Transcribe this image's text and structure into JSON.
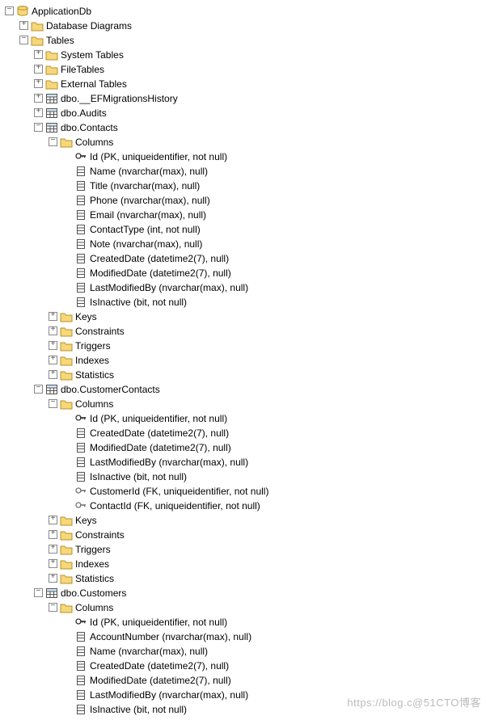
{
  "watermark": "https://blog.c@51CTO博客",
  "tree": [
    {
      "d": 0,
      "t": "minus",
      "i": "db",
      "name": "db-applicationdb",
      "label": "ApplicationDb"
    },
    {
      "d": 1,
      "t": "plus",
      "i": "folder",
      "name": "folder-database-diagrams",
      "label": "Database Diagrams"
    },
    {
      "d": 1,
      "t": "minus",
      "i": "folder",
      "name": "folder-tables",
      "label": "Tables"
    },
    {
      "d": 2,
      "t": "plus",
      "i": "folder",
      "name": "folder-system-tables",
      "label": "System Tables"
    },
    {
      "d": 2,
      "t": "plus",
      "i": "folder",
      "name": "folder-file-tables",
      "label": "FileTables"
    },
    {
      "d": 2,
      "t": "plus",
      "i": "folder",
      "name": "folder-external-tables",
      "label": "External Tables"
    },
    {
      "d": 2,
      "t": "plus",
      "i": "table",
      "name": "table-efmigrationshistory",
      "label": "dbo.__EFMigrationsHistory"
    },
    {
      "d": 2,
      "t": "plus",
      "i": "table",
      "name": "table-audits",
      "label": "dbo.Audits"
    },
    {
      "d": 2,
      "t": "minus",
      "i": "table",
      "name": "table-contacts",
      "label": "dbo.Contacts"
    },
    {
      "d": 3,
      "t": "minus",
      "i": "folder",
      "name": "folder-contacts-columns",
      "label": "Columns"
    },
    {
      "d": 4,
      "t": "",
      "i": "pk",
      "name": "col-contacts-id",
      "label": "Id (PK, uniqueidentifier, not null)"
    },
    {
      "d": 4,
      "t": "",
      "i": "col",
      "name": "col-contacts-name",
      "label": "Name (nvarchar(max), null)"
    },
    {
      "d": 4,
      "t": "",
      "i": "col",
      "name": "col-contacts-title",
      "label": "Title (nvarchar(max), null)"
    },
    {
      "d": 4,
      "t": "",
      "i": "col",
      "name": "col-contacts-phone",
      "label": "Phone (nvarchar(max), null)"
    },
    {
      "d": 4,
      "t": "",
      "i": "col",
      "name": "col-contacts-email",
      "label": "Email (nvarchar(max), null)"
    },
    {
      "d": 4,
      "t": "",
      "i": "col",
      "name": "col-contacts-contacttype",
      "label": "ContactType (int, not null)"
    },
    {
      "d": 4,
      "t": "",
      "i": "col",
      "name": "col-contacts-note",
      "label": "Note (nvarchar(max), null)"
    },
    {
      "d": 4,
      "t": "",
      "i": "col",
      "name": "col-contacts-createddate",
      "label": "CreatedDate (datetime2(7), null)"
    },
    {
      "d": 4,
      "t": "",
      "i": "col",
      "name": "col-contacts-modifieddate",
      "label": "ModifiedDate (datetime2(7), null)"
    },
    {
      "d": 4,
      "t": "",
      "i": "col",
      "name": "col-contacts-lastmodifiedby",
      "label": "LastModifiedBy (nvarchar(max), null)"
    },
    {
      "d": 4,
      "t": "",
      "i": "col",
      "name": "col-contacts-isinactive",
      "label": "IsInactive (bit, not null)"
    },
    {
      "d": 3,
      "t": "plus",
      "i": "folder",
      "name": "folder-contacts-keys",
      "label": "Keys"
    },
    {
      "d": 3,
      "t": "plus",
      "i": "folder",
      "name": "folder-contacts-constraints",
      "label": "Constraints"
    },
    {
      "d": 3,
      "t": "plus",
      "i": "folder",
      "name": "folder-contacts-triggers",
      "label": "Triggers"
    },
    {
      "d": 3,
      "t": "plus",
      "i": "folder",
      "name": "folder-contacts-indexes",
      "label": "Indexes"
    },
    {
      "d": 3,
      "t": "plus",
      "i": "folder",
      "name": "folder-contacts-statistics",
      "label": "Statistics"
    },
    {
      "d": 2,
      "t": "minus",
      "i": "table",
      "name": "table-customercontacts",
      "label": "dbo.CustomerContacts"
    },
    {
      "d": 3,
      "t": "minus",
      "i": "folder",
      "name": "folder-cc-columns",
      "label": "Columns"
    },
    {
      "d": 4,
      "t": "",
      "i": "pk",
      "name": "col-cc-id",
      "label": "Id (PK, uniqueidentifier, not null)"
    },
    {
      "d": 4,
      "t": "",
      "i": "col",
      "name": "col-cc-createddate",
      "label": "CreatedDate (datetime2(7), null)"
    },
    {
      "d": 4,
      "t": "",
      "i": "col",
      "name": "col-cc-modifieddate",
      "label": "ModifiedDate (datetime2(7), null)"
    },
    {
      "d": 4,
      "t": "",
      "i": "col",
      "name": "col-cc-lastmodifiedby",
      "label": "LastModifiedBy (nvarchar(max), null)"
    },
    {
      "d": 4,
      "t": "",
      "i": "col",
      "name": "col-cc-isinactive",
      "label": "IsInactive (bit, not null)"
    },
    {
      "d": 4,
      "t": "",
      "i": "fk",
      "name": "col-cc-customerid",
      "label": "CustomerId (FK, uniqueidentifier, not null)"
    },
    {
      "d": 4,
      "t": "",
      "i": "fk",
      "name": "col-cc-contactid",
      "label": "ContactId (FK, uniqueidentifier, not null)"
    },
    {
      "d": 3,
      "t": "plus",
      "i": "folder",
      "name": "folder-cc-keys",
      "label": "Keys"
    },
    {
      "d": 3,
      "t": "plus",
      "i": "folder",
      "name": "folder-cc-constraints",
      "label": "Constraints"
    },
    {
      "d": 3,
      "t": "plus",
      "i": "folder",
      "name": "folder-cc-triggers",
      "label": "Triggers"
    },
    {
      "d": 3,
      "t": "plus",
      "i": "folder",
      "name": "folder-cc-indexes",
      "label": "Indexes"
    },
    {
      "d": 3,
      "t": "plus",
      "i": "folder",
      "name": "folder-cc-statistics",
      "label": "Statistics"
    },
    {
      "d": 2,
      "t": "minus",
      "i": "table",
      "name": "table-customers",
      "label": "dbo.Customers"
    },
    {
      "d": 3,
      "t": "minus",
      "i": "folder",
      "name": "folder-cust-columns",
      "label": "Columns"
    },
    {
      "d": 4,
      "t": "",
      "i": "pk",
      "name": "col-cust-id",
      "label": "Id (PK, uniqueidentifier, not null)"
    },
    {
      "d": 4,
      "t": "",
      "i": "col",
      "name": "col-cust-accountnumber",
      "label": "AccountNumber (nvarchar(max), null)"
    },
    {
      "d": 4,
      "t": "",
      "i": "col",
      "name": "col-cust-name",
      "label": "Name (nvarchar(max), null)"
    },
    {
      "d": 4,
      "t": "",
      "i": "col",
      "name": "col-cust-createddate",
      "label": "CreatedDate (datetime2(7), null)"
    },
    {
      "d": 4,
      "t": "",
      "i": "col",
      "name": "col-cust-modifieddate",
      "label": "ModifiedDate (datetime2(7), null)"
    },
    {
      "d": 4,
      "t": "",
      "i": "col",
      "name": "col-cust-lastmodifiedby",
      "label": "LastModifiedBy (nvarchar(max), null)"
    },
    {
      "d": 4,
      "t": "",
      "i": "col",
      "name": "col-cust-isinactive",
      "label": "IsInactive (bit, not null)"
    }
  ]
}
